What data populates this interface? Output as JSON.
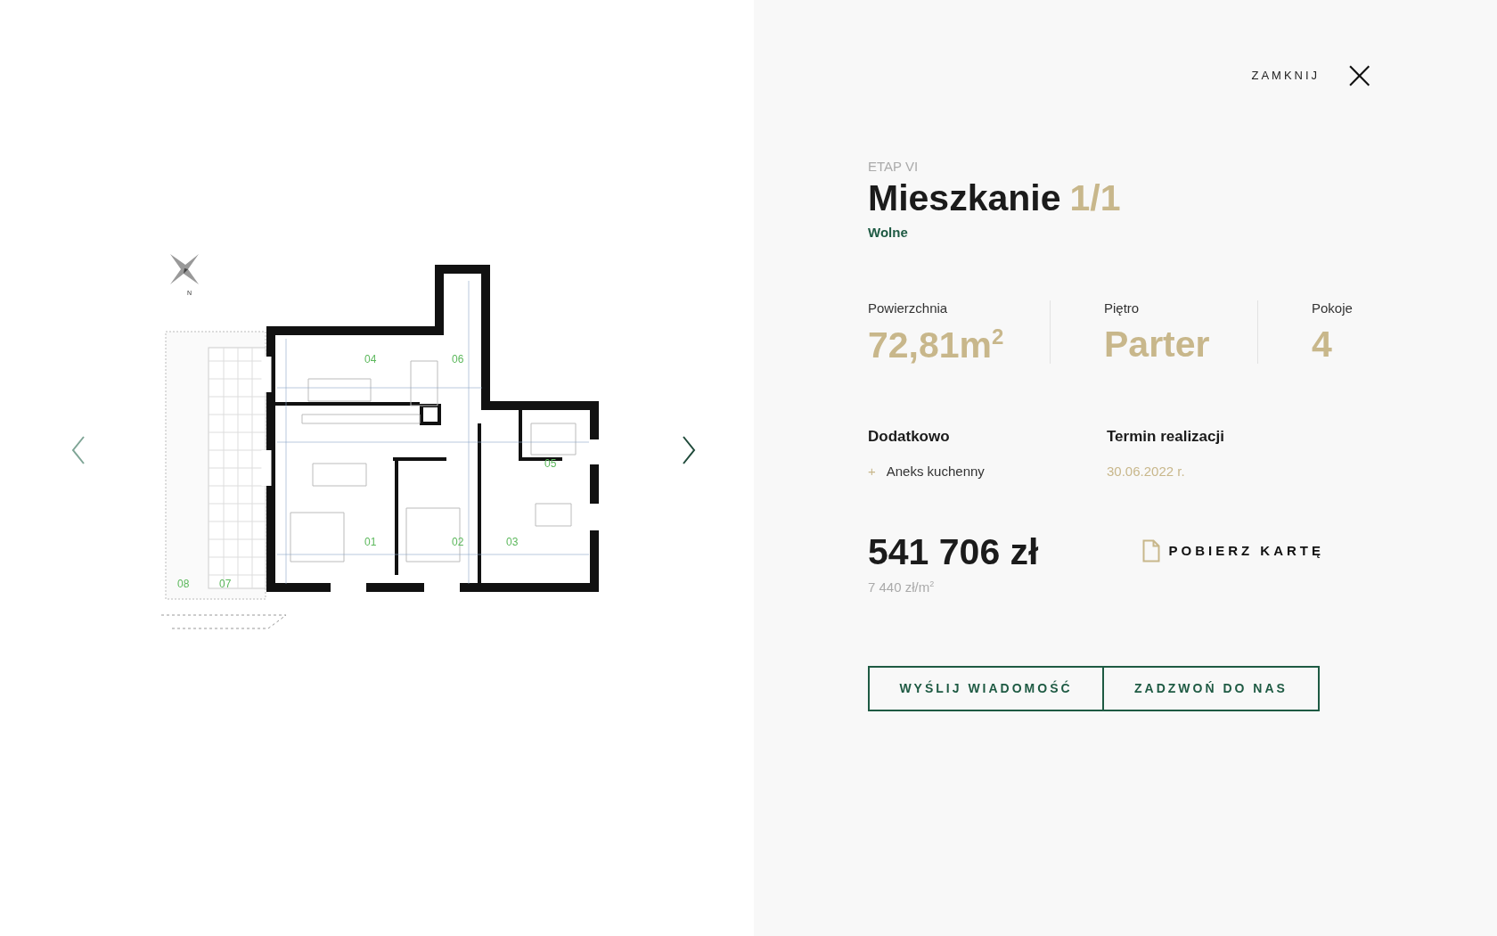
{
  "close": {
    "label": "ZAMKNIJ",
    "icon": "×"
  },
  "plan": {
    "compass_label": "N",
    "rooms": [
      {
        "label": "04"
      },
      {
        "label": "06"
      },
      {
        "label": "05"
      },
      {
        "label": "01"
      },
      {
        "label": "02"
      },
      {
        "label": "03"
      },
      {
        "label": "08"
      },
      {
        "label": "07"
      }
    ]
  },
  "stage": "ETAP VI",
  "title": {
    "name": "Mieszkanie",
    "number": "1/1"
  },
  "status": "Wolne",
  "stats": [
    {
      "label": "Powierzchnia",
      "value": "72,81m$^{2}$"
    },
    {
      "label": "Piętro",
      "value": "Parter"
    },
    {
      "label": "Pokoje",
      "value": "4"
    }
  ],
  "extras": {
    "heading": "Dodatkowo",
    "items": [
      {
        "marker": "+",
        "text": "Aneks kuchenny"
      }
    ]
  },
  "completion": {
    "heading": "Termin realizacji",
    "date": "30.06.2022 r."
  },
  "price": {
    "total": "541 706 zł",
    "per_m2": "7 440 zł/m$^{2}$"
  },
  "download": "POBIERZ KARTĘ",
  "buttons": [
    "WYŚLIJ WIADOMOŚĆ",
    "ZADZWOŃ DO NAS"
  ]
}
